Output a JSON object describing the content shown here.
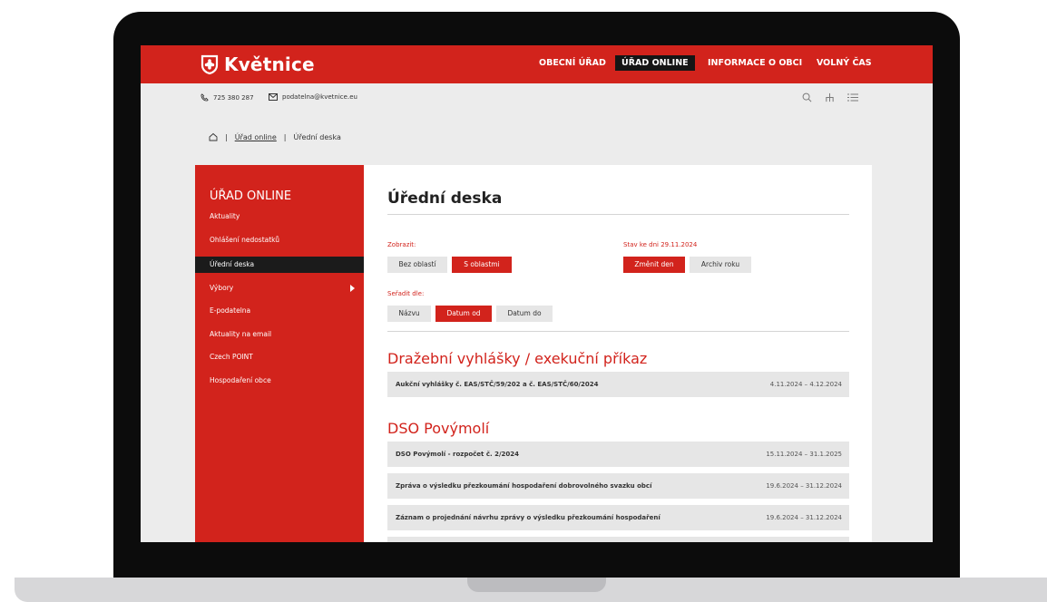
{
  "header": {
    "brand": "Květnice",
    "nav": [
      "OBECNÍ ÚŘAD",
      "ÚŘAD ONLINE",
      "INFORMACE O OBCI",
      "VOLNÝ ČAS"
    ],
    "active_nav": "ÚŘAD ONLINE",
    "phone": "725 380 287",
    "email": "podatelna@kvetnice.eu",
    "accent_color": "#d2231c"
  },
  "breadcrumb": {
    "items": [
      "Úřad online",
      "Úřední deska"
    ]
  },
  "sidebar": {
    "title": "ÚŘAD ONLINE",
    "items": [
      {
        "label": "Aktuality"
      },
      {
        "label": "Ohlášení nedostatků"
      },
      {
        "label": "Úřední deska",
        "active": true
      },
      {
        "label": "Výbory",
        "has_submenu": true
      },
      {
        "label": "E-podatelna"
      },
      {
        "label": "Aktuality na email"
      },
      {
        "label": "Czech POINT"
      },
      {
        "label": "Hospodaření obce"
      }
    ]
  },
  "main": {
    "title": "Úřední deska",
    "show_label": "Zobrazit:",
    "show_options": [
      "Bez oblastí",
      "S oblastmi"
    ],
    "show_selected": "S oblastmi",
    "state_label": "Stav ke dni 29.11.2024",
    "state_buttons": [
      "Změnit den",
      "Archiv roku"
    ],
    "sort_label": "Seřadit dle:",
    "sort_options": [
      "Názvu",
      "Datum od",
      "Datum do"
    ],
    "sort_selected": "Datum od",
    "sections": [
      {
        "title": "Dražební vyhlášky / exekuční příkaz",
        "rows": [
          {
            "title": "Aukční vyhlášky č. EAS/STČ/59/202 a č. EAS/STČ/60/2024",
            "dates": "4.11.2024 – 4.12.2024"
          }
        ]
      },
      {
        "title": "DSO Povýmolí",
        "rows": [
          {
            "title": "DSO Povýmolí - rozpočet č. 2/2024",
            "dates": "15.11.2024 – 31.1.2025"
          },
          {
            "title": "Zpráva o výsledku přezkoumání hospodaření dobrovolného svazku obcí",
            "dates": "19.6.2024 – 31.12.2024"
          },
          {
            "title": "Záznam o projednání návrhu zprávy o výsledku přezkoumání hospodaření",
            "dates": "19.6.2024 – 31.12.2024"
          }
        ]
      }
    ]
  }
}
